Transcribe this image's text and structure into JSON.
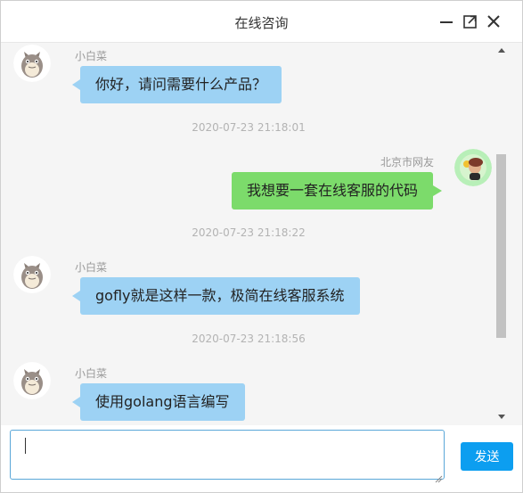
{
  "window": {
    "title": "在线咨询"
  },
  "chat": {
    "messages": [
      {
        "side": "left",
        "sender": "小白菜",
        "text": "你好，请问需要什么产品？",
        "avatar": "totoro-avatar"
      },
      {
        "side": "right",
        "sender": "北京市网友",
        "text": "我想要一套在线客服的代码",
        "avatar": "user-avatar",
        "timestamp_before": "2020-07-23 21:18:01"
      },
      {
        "side": "left",
        "sender": "小白菜",
        "text": "gofly就是这样一款，极简在线客服系统",
        "avatar": "totoro-avatar",
        "timestamp_before": "2020-07-23 21:18:22"
      },
      {
        "side": "left",
        "sender": "小白菜",
        "text": "使用golang语言编写",
        "avatar": "totoro-avatar",
        "timestamp_before": "2020-07-23 21:18:56"
      }
    ]
  },
  "composer": {
    "input_value": "",
    "send_label": "发送"
  },
  "colors": {
    "agent_bubble": "#9dd2f4",
    "user_bubble": "#7cdb6b",
    "send_button": "#0c9ef0",
    "input_border": "#5aa7d8"
  }
}
